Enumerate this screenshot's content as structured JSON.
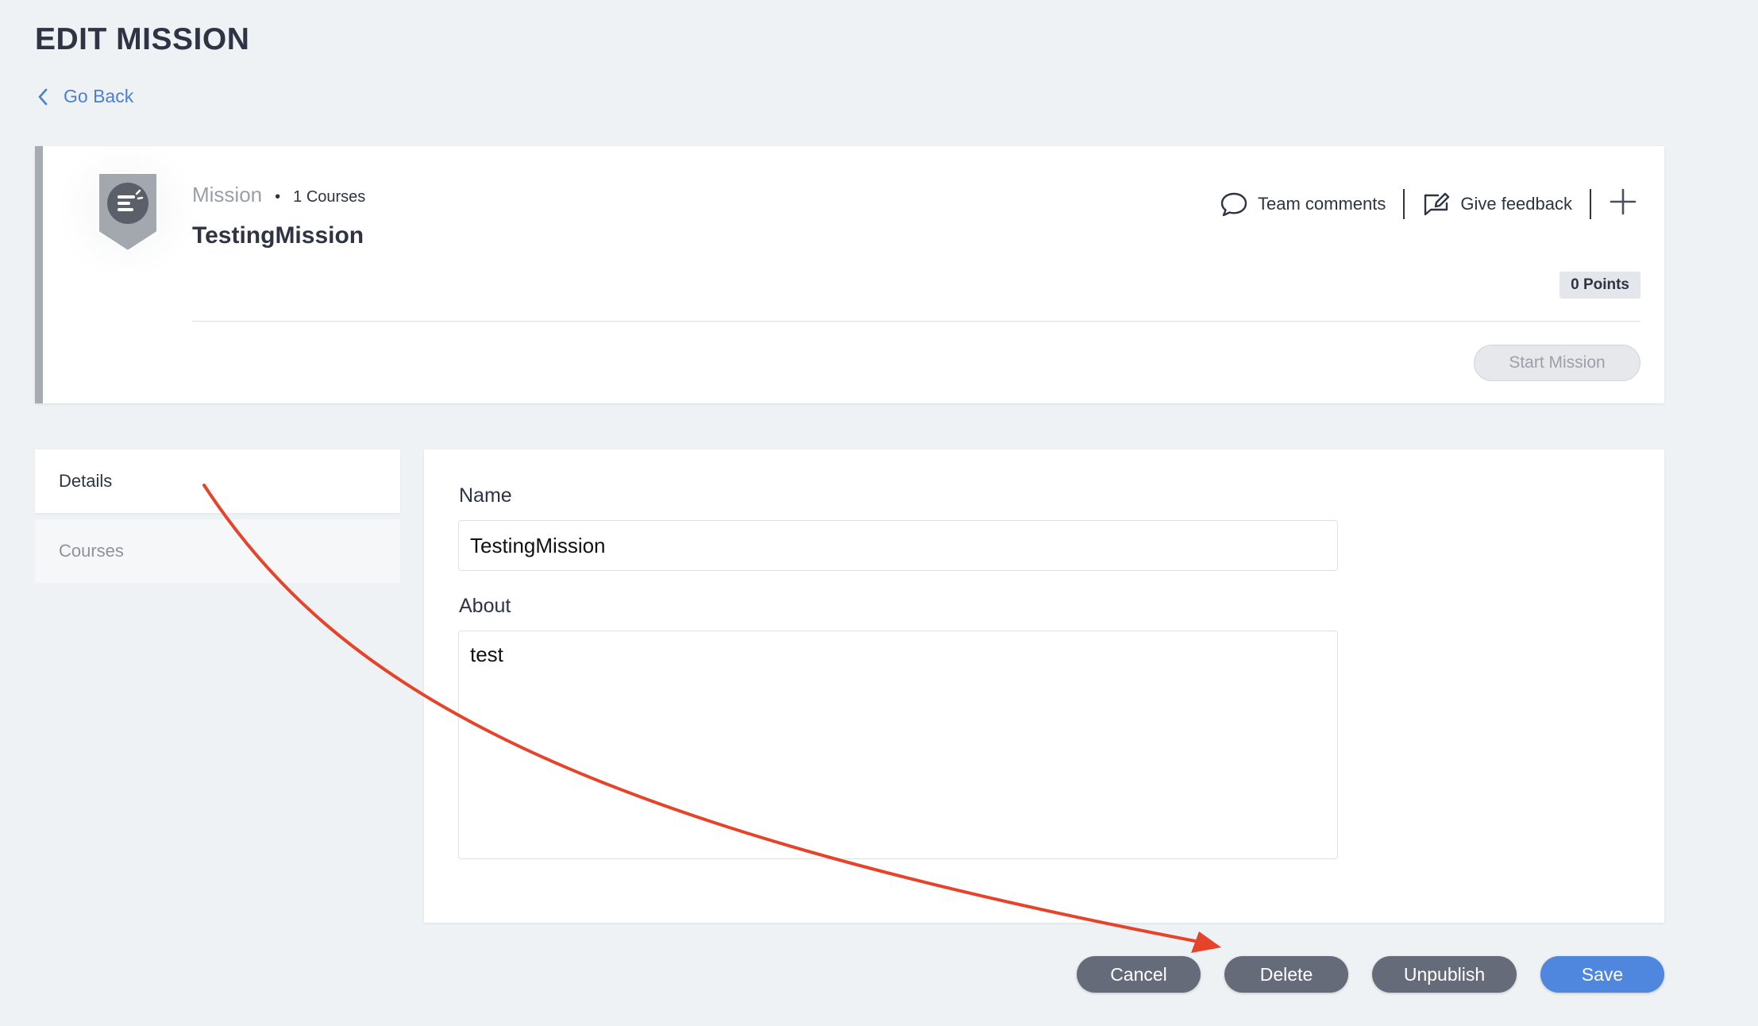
{
  "page": {
    "title": "EDIT MISSION",
    "back_label": "Go Back"
  },
  "mission": {
    "type_label": "Mission",
    "separator": "•",
    "courses_label": "1 Courses",
    "name": "TestingMission",
    "points_label": "0 Points",
    "start_label": "Start Mission",
    "actions": {
      "comments_label": "Team comments",
      "feedback_label": "Give feedback"
    }
  },
  "sidebar": {
    "items": [
      {
        "label": "Details",
        "active": true
      },
      {
        "label": "Courses",
        "active": false
      }
    ]
  },
  "form": {
    "name_label": "Name",
    "name_value": "TestingMission",
    "about_label": "About",
    "about_value": "test"
  },
  "footer": {
    "cancel_label": "Cancel",
    "delete_label": "Delete",
    "unpublish_label": "Unpublish",
    "save_label": "Save"
  },
  "colors": {
    "accent": "#4f87df",
    "link": "#4a7fd4",
    "button_dark": "#656b79",
    "annotation_arrow": "#e5432a"
  }
}
